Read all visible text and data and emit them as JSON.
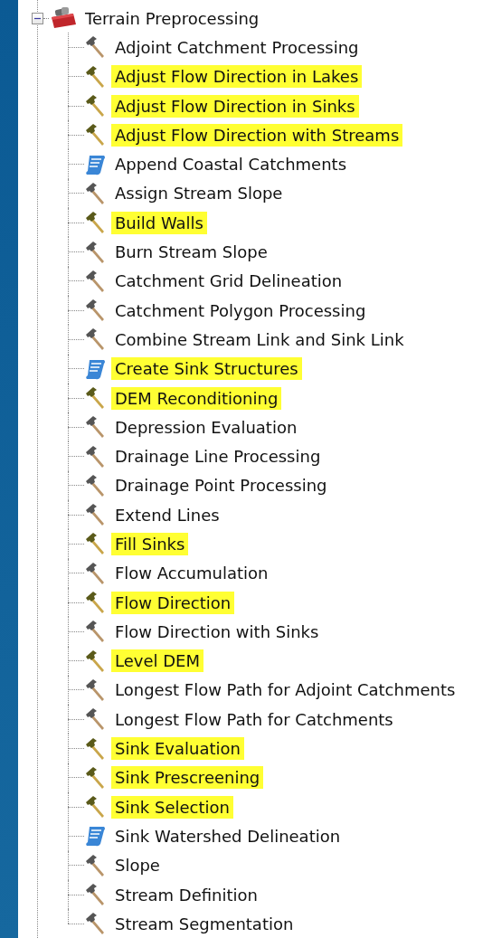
{
  "tree": {
    "label": "Terrain Preprocessing",
    "expanded": true,
    "children": [
      {
        "label": "Adjoint Catchment Processing",
        "kind": "tool",
        "highlighted": false
      },
      {
        "label": "Adjust Flow Direction in Lakes",
        "kind": "tool",
        "highlighted": true
      },
      {
        "label": "Adjust Flow Direction in Sinks",
        "kind": "tool",
        "highlighted": true
      },
      {
        "label": "Adjust Flow Direction with Streams",
        "kind": "tool",
        "highlighted": true
      },
      {
        "label": "Append Coastal Catchments",
        "kind": "script",
        "highlighted": false
      },
      {
        "label": "Assign Stream Slope",
        "kind": "tool",
        "highlighted": false
      },
      {
        "label": "Build Walls",
        "kind": "tool",
        "highlighted": true
      },
      {
        "label": "Burn Stream Slope",
        "kind": "tool",
        "highlighted": false
      },
      {
        "label": "Catchment Grid Delineation",
        "kind": "tool",
        "highlighted": false
      },
      {
        "label": "Catchment Polygon Processing",
        "kind": "tool",
        "highlighted": false
      },
      {
        "label": "Combine Stream Link and Sink Link",
        "kind": "tool",
        "highlighted": false
      },
      {
        "label": "Create Sink Structures",
        "kind": "script",
        "highlighted": true
      },
      {
        "label": "DEM Reconditioning",
        "kind": "tool",
        "highlighted": true
      },
      {
        "label": "Depression Evaluation",
        "kind": "tool",
        "highlighted": false
      },
      {
        "label": "Drainage Line Processing",
        "kind": "tool",
        "highlighted": false
      },
      {
        "label": "Drainage Point Processing",
        "kind": "tool",
        "highlighted": false
      },
      {
        "label": "Extend Lines",
        "kind": "tool",
        "highlighted": false
      },
      {
        "label": "Fill Sinks",
        "kind": "tool",
        "highlighted": true
      },
      {
        "label": "Flow Accumulation",
        "kind": "tool",
        "highlighted": false
      },
      {
        "label": "Flow Direction",
        "kind": "tool",
        "highlighted": true
      },
      {
        "label": "Flow Direction with Sinks",
        "kind": "tool",
        "highlighted": false
      },
      {
        "label": "Level DEM",
        "kind": "tool",
        "highlighted": true
      },
      {
        "label": "Longest Flow Path for Adjoint Catchments",
        "kind": "tool",
        "highlighted": false
      },
      {
        "label": "Longest Flow Path for Catchments",
        "kind": "tool",
        "highlighted": false
      },
      {
        "label": "Sink Evaluation",
        "kind": "tool",
        "highlighted": true
      },
      {
        "label": "Sink Prescreening",
        "kind": "tool",
        "highlighted": true
      },
      {
        "label": "Sink Selection",
        "kind": "tool",
        "highlighted": true
      },
      {
        "label": "Sink Watershed Delineation",
        "kind": "script",
        "highlighted": false
      },
      {
        "label": "Slope",
        "kind": "tool",
        "highlighted": false
      },
      {
        "label": "Stream Definition",
        "kind": "tool",
        "highlighted": false
      },
      {
        "label": "Stream Segmentation",
        "kind": "tool",
        "highlighted": false
      }
    ]
  }
}
